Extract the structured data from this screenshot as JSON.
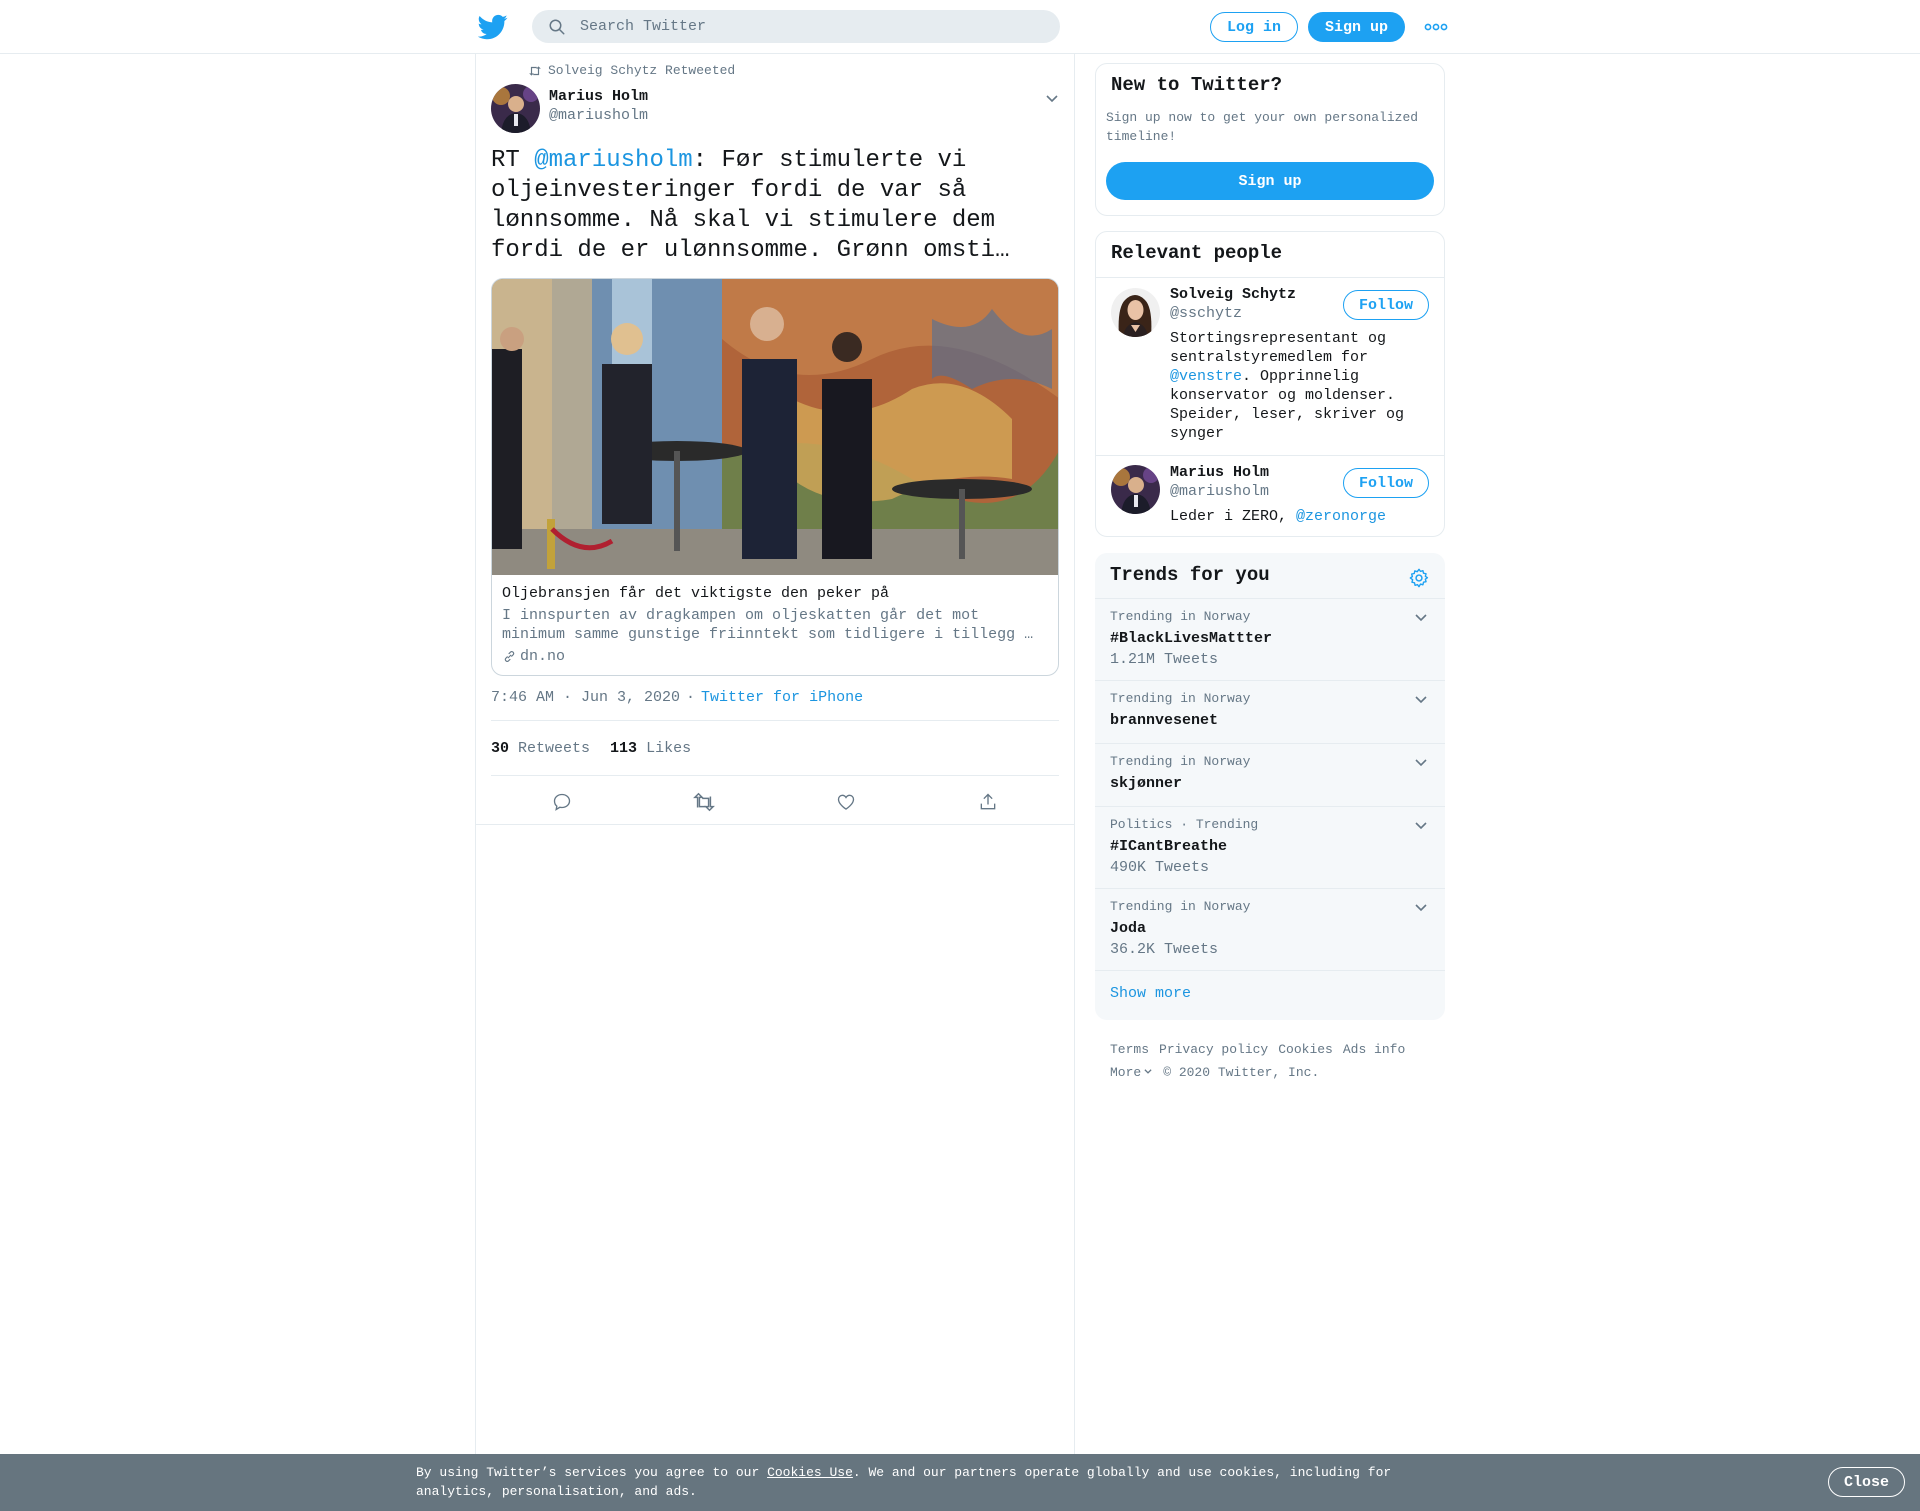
{
  "header": {
    "search_placeholder": "Search Twitter",
    "login_label": "Log in",
    "signup_label": "Sign up"
  },
  "tweet": {
    "retweeted_by": "Solveig Schytz Retweeted",
    "author_name": "Marius Holm",
    "author_handle": "@mariusholm",
    "text_prefix": "RT ",
    "text_mention": "@mariusholm",
    "text_body": ": Før stimulerte vi oljeinvesteringer fordi de var så lønnsomme. Nå skal vi stimulere dem fordi de er ulønnsomme. Grønn omsti…",
    "card": {
      "title": "Oljebransjen får det viktigste den peker på",
      "description": "I innspurten av dragkampen om oljeskatten går det mot minimum samme gunstige friinntekt som tidligere i tillegg …",
      "domain": "dn.no"
    },
    "time": "7:46 AM · Jun 3, 2020",
    "source_sep": "·",
    "source": "Twitter for iPhone",
    "retweets_count": "30",
    "retweets_label": "Retweets",
    "likes_count": "113",
    "likes_label": "Likes"
  },
  "new_to_twitter": {
    "title": "New to Twitter?",
    "text": "Sign up now to get your own personalized timeline!",
    "button": "Sign up"
  },
  "relevant_people": {
    "title": "Relevant people",
    "people": [
      {
        "name": "Solveig Schytz",
        "handle": "@sschytz",
        "follow": "Follow",
        "bio_before": "Stortingsrepresentant og sentralstyremedlem for ",
        "bio_mention": "@venstre",
        "bio_after": ". Opprinnelig konservator og moldenser. Speider, leser, skriver og synger"
      },
      {
        "name": "Marius Holm",
        "handle": "@mariusholm",
        "follow": "Follow",
        "bio_before": "Leder i ZERO, ",
        "bio_mention": "@zeronorge",
        "bio_after": ""
      }
    ]
  },
  "trends": {
    "title": "Trends for you",
    "items": [
      {
        "context": "Trending in Norway",
        "topic": "#BlackLivesMattter",
        "count": "1.21M Tweets"
      },
      {
        "context": "Trending in Norway",
        "topic": "brannvesenet",
        "count": ""
      },
      {
        "context": "Trending in Norway",
        "topic": "skjønner",
        "count": ""
      },
      {
        "context": "Politics · Trending",
        "topic": "#ICantBreathe",
        "count": "490K Tweets"
      },
      {
        "context": "Trending in Norway",
        "topic": "Joda",
        "count": "36.2K Tweets"
      }
    ],
    "show_more": "Show more"
  },
  "footer": {
    "terms": "Terms",
    "privacy": "Privacy policy",
    "cookies": "Cookies",
    "ads": "Ads info",
    "more": "More",
    "copyright": "© 2020 Twitter, Inc."
  },
  "cookie_banner": {
    "text_before": "By using Twitter’s services you agree to our ",
    "link": "Cookies Use",
    "text_after": ". We and our partners operate globally and use cookies, including for analytics, personalisation, and ads.",
    "close": "Close"
  },
  "colors": {
    "brand": "#1da1f2",
    "link": "#1b95e0",
    "muted": "#657786",
    "banner": "#66757f"
  }
}
